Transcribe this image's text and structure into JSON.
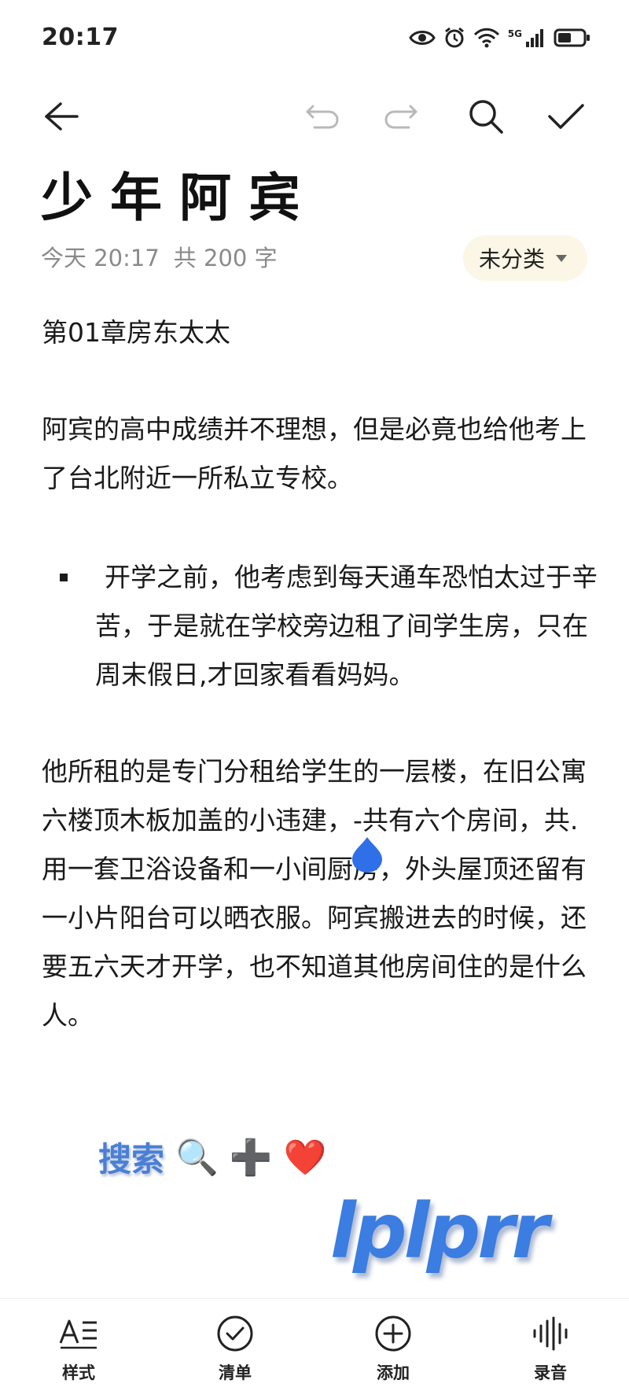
{
  "status_bar": {
    "time": "20:17",
    "network_label": "5G"
  },
  "toolbar": {
    "back_icon": "arrow-left-icon",
    "undo_icon": "undo-icon",
    "redo_icon": "redo-icon",
    "search_icon": "search-icon",
    "done_icon": "check-icon"
  },
  "note": {
    "title": "少年阿宾",
    "date": "今天 20:17",
    "word_count": "共 200 字",
    "category": "未分类",
    "chapter": "第01章房东太太",
    "paragraph1": "阿宾的高中成绩并不理想，但是必竟也给他考上了台北附近一所私立专校。",
    "bullet1": "开学之前，他考虑到每天通车恐怕太过于辛苦，于是就在学校旁边租了间学生房，只在周末假日,才回家看看妈妈。",
    "paragraph2": "他所租的是专门分租给学生的一层楼，在旧公寓六楼顶木板加盖的小违建，-共有六个房间，共.用一套卫浴设备和一小间厨房，外头屋顶还留有一小片阳台可以晒衣服。阿宾搬进去的时候，还要五六天才开学，也不知道其他房间住的是什么人。"
  },
  "overlay": {
    "search_label": "搜索",
    "emojis": [
      "🔍",
      "➕",
      "❤️"
    ],
    "word": "lplprr"
  },
  "bottom_bar": {
    "items": [
      {
        "label": "样式",
        "icon": "text-style-icon"
      },
      {
        "label": "清单",
        "icon": "checklist-icon"
      },
      {
        "label": "添加",
        "icon": "add-icon"
      },
      {
        "label": "录音",
        "icon": "voice-record-icon"
      }
    ]
  },
  "colors": {
    "accent_blue": "#2f6fe8",
    "category_bg": "#fbf6e6",
    "meta_gray": "#8a8a8a"
  }
}
